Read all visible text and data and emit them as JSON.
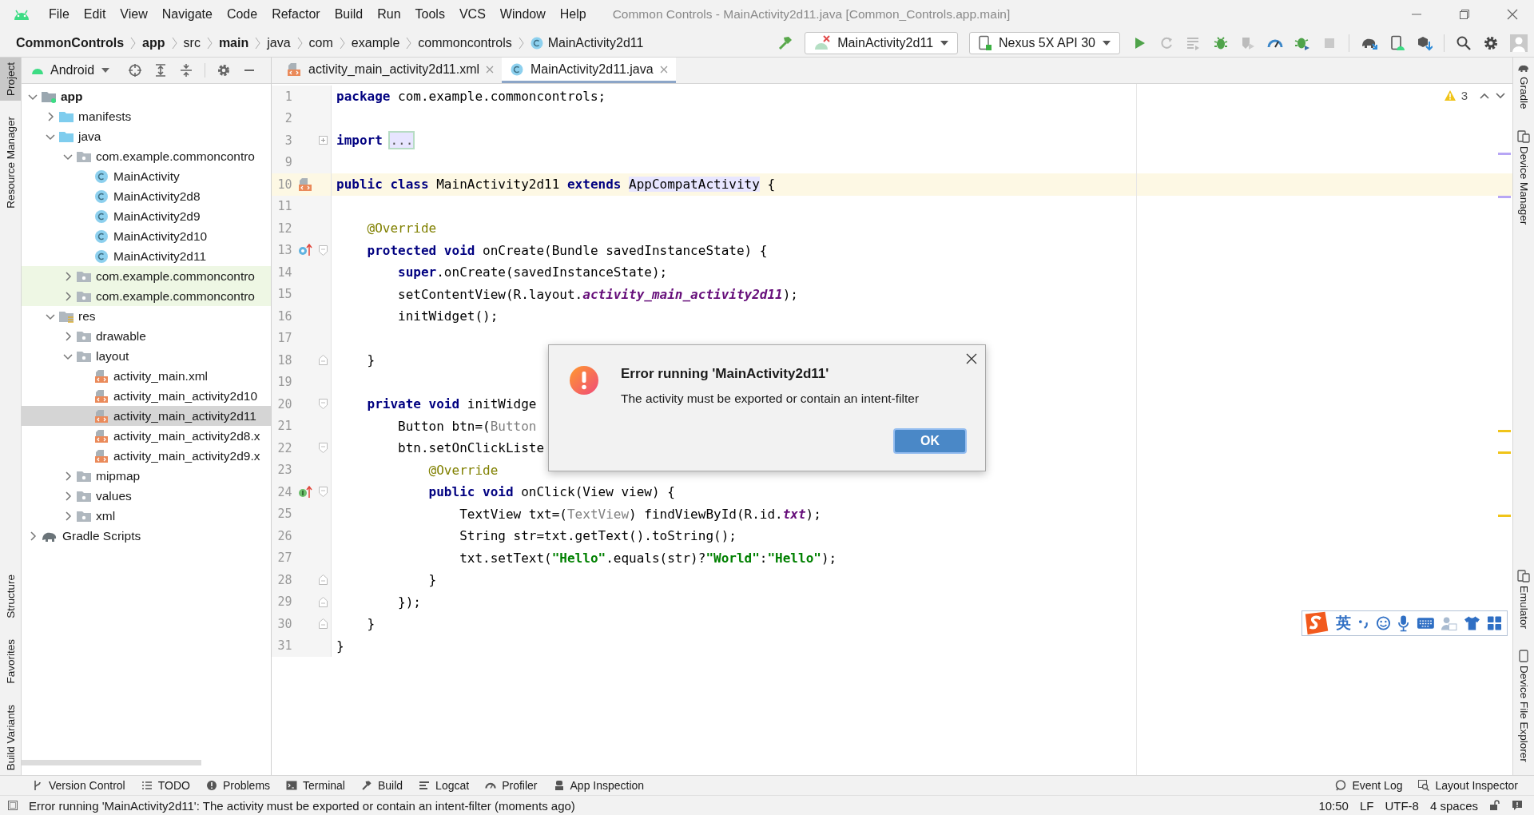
{
  "window": {
    "title": "Common Controls - MainActivity2d11.java [Common_Controls.app.main]"
  },
  "menu": [
    "File",
    "Edit",
    "View",
    "Navigate",
    "Code",
    "Refactor",
    "Build",
    "Run",
    "Tools",
    "VCS",
    "Window",
    "Help"
  ],
  "breadcrumb": [
    {
      "label": "CommonControls",
      "bold": true,
      "kind": "plain"
    },
    {
      "label": "app",
      "bold": true,
      "kind": "plain"
    },
    {
      "label": "src",
      "bold": false,
      "kind": "plain"
    },
    {
      "label": "main",
      "bold": true,
      "kind": "plain"
    },
    {
      "label": "java",
      "bold": false,
      "kind": "plain"
    },
    {
      "label": "com",
      "bold": false,
      "kind": "plain"
    },
    {
      "label": "example",
      "bold": false,
      "kind": "plain"
    },
    {
      "label": "commoncontrols",
      "bold": false,
      "kind": "plain"
    },
    {
      "label": "MainActivity2d11",
      "bold": false,
      "kind": "class"
    }
  ],
  "run_config": {
    "label": "MainActivity2d11"
  },
  "device": {
    "label": "Nexus 5X API 30"
  },
  "left_stripe": {
    "top": [
      {
        "label": "Project",
        "selected": true
      },
      {
        "label": "Resource Manager",
        "selected": false
      }
    ],
    "bottom": [
      {
        "label": "Structure",
        "selected": false
      },
      {
        "label": "Favorites",
        "selected": false
      },
      {
        "label": "Build Variants",
        "selected": false
      }
    ]
  },
  "right_stripe": {
    "top": [
      {
        "label": "Gradle",
        "kind": "elephant"
      },
      {
        "label": "Device Manager",
        "kind": "devices"
      }
    ],
    "bottom": [
      {
        "label": "Emulator",
        "kind": "devices"
      },
      {
        "label": "Device File Explorer",
        "kind": "phone"
      }
    ]
  },
  "project": {
    "view": "Android",
    "tree": [
      {
        "label": "app",
        "kind": "module",
        "expanded": true,
        "selected": false,
        "tinted": false,
        "children": [
          {
            "label": "manifests",
            "kind": "source-folder",
            "expanded": false,
            "selected": false,
            "tinted": false
          },
          {
            "label": "java",
            "kind": "source-folder",
            "expanded": true,
            "selected": false,
            "tinted": false,
            "children": [
              {
                "label": "com.example.commoncontro",
                "kind": "package",
                "expanded": true,
                "selected": false,
                "tinted": false,
                "children": [
                  {
                    "label": "MainActivity",
                    "kind": "class",
                    "selected": false,
                    "tinted": false
                  },
                  {
                    "label": "MainActivity2d8",
                    "kind": "class",
                    "selected": false,
                    "tinted": false
                  },
                  {
                    "label": "MainActivity2d9",
                    "kind": "class",
                    "selected": false,
                    "tinted": false
                  },
                  {
                    "label": "MainActivity2d10",
                    "kind": "class",
                    "selected": false,
                    "tinted": false
                  },
                  {
                    "label": "MainActivity2d11",
                    "kind": "class",
                    "selected": false,
                    "tinted": false
                  }
                ]
              },
              {
                "label": "com.example.commoncontro",
                "kind": "package",
                "expanded": false,
                "selected": false,
                "tinted": true
              },
              {
                "label": "com.example.commoncontro",
                "kind": "package",
                "expanded": false,
                "selected": false,
                "tinted": true
              }
            ]
          },
          {
            "label": "res",
            "kind": "res-folder",
            "expanded": true,
            "selected": false,
            "tinted": false,
            "children": [
              {
                "label": "drawable",
                "kind": "package",
                "expanded": false,
                "selected": false,
                "tinted": false
              },
              {
                "label": "layout",
                "kind": "package",
                "expanded": true,
                "selected": false,
                "tinted": false,
                "children": [
                  {
                    "label": "activity_main.xml",
                    "kind": "xml",
                    "selected": false,
                    "tinted": false
                  },
                  {
                    "label": "activity_main_activity2d10",
                    "kind": "xml",
                    "selected": false,
                    "tinted": false
                  },
                  {
                    "label": "activity_main_activity2d11",
                    "kind": "xml",
                    "selected": true,
                    "tinted": false
                  },
                  {
                    "label": "activity_main_activity2d8.x",
                    "kind": "xml",
                    "selected": false,
                    "tinted": false
                  },
                  {
                    "label": "activity_main_activity2d9.x",
                    "kind": "xml",
                    "selected": false,
                    "tinted": false
                  }
                ]
              },
              {
                "label": "mipmap",
                "kind": "package",
                "expanded": false,
                "selected": false,
                "tinted": false
              },
              {
                "label": "values",
                "kind": "package",
                "expanded": false,
                "selected": false,
                "tinted": false
              },
              {
                "label": "xml",
                "kind": "package",
                "expanded": false,
                "selected": false,
                "tinted": false
              }
            ]
          }
        ]
      },
      {
        "label": "Gradle Scripts",
        "kind": "gradle",
        "expanded": false,
        "selected": false,
        "tinted": false
      }
    ]
  },
  "editor": {
    "tabs": [
      {
        "label": "activity_main_activity2d11.xml",
        "kind": "xml",
        "selected": false
      },
      {
        "label": "MainActivity2d11.java",
        "kind": "class",
        "selected": true
      }
    ],
    "warnings": "3",
    "lines": [
      {
        "number": "1",
        "current": false,
        "tokens": [
          {
            "kind": "keyword",
            "text": "package"
          },
          {
            "kind": "plain",
            "text": " com.example.commoncontrols;"
          }
        ]
      },
      {
        "number": "2",
        "current": false
      },
      {
        "number": "3",
        "current": false,
        "fold": {
          "kind": "collapsed"
        },
        "tokens": [
          {
            "kind": "keyword",
            "text": "import "
          },
          {
            "kind": "folded",
            "text": "..."
          }
        ]
      },
      {
        "number": "9",
        "current": false
      },
      {
        "number": "10",
        "current": true,
        "marker": {
          "kind": "xml"
        },
        "tokens": [
          {
            "kind": "keyword",
            "text": "public class"
          },
          {
            "kind": "plain",
            "text": " MainActivity2d11 "
          },
          {
            "kind": "keyword",
            "text": "extends "
          },
          {
            "kind": "highlight",
            "text": "AppCompatActivity"
          },
          {
            "kind": "plain",
            "text": " {"
          }
        ]
      },
      {
        "number": "11",
        "current": false
      },
      {
        "number": "12",
        "current": false,
        "tokens": [
          {
            "kind": "annotation",
            "text": "    @Override"
          }
        ]
      },
      {
        "number": "13",
        "current": false,
        "marker": {
          "kind": "override"
        },
        "fold": {
          "kind": "start"
        },
        "tokens": [
          {
            "kind": "keyword",
            "text": "    protected void"
          },
          {
            "kind": "plain",
            "text": " onCreate(Bundle savedInstanceState) {"
          }
        ]
      },
      {
        "number": "14",
        "current": false,
        "tokens": [
          {
            "kind": "keyword",
            "text": "        super"
          },
          {
            "kind": "plain",
            "text": ".onCreate(savedInstanceState);"
          }
        ]
      },
      {
        "number": "15",
        "current": false,
        "tokens": [
          {
            "kind": "plain",
            "text": "        setContentView(R.layout."
          },
          {
            "kind": "field",
            "text": "activity_main_activity2d11"
          },
          {
            "kind": "plain",
            "text": ");"
          }
        ]
      },
      {
        "number": "16",
        "current": false,
        "tokens": [
          {
            "kind": "plain",
            "text": "        initWidget();"
          }
        ]
      },
      {
        "number": "17",
        "current": false
      },
      {
        "number": "18",
        "current": false,
        "fold": {
          "kind": "end"
        },
        "tokens": [
          {
            "kind": "plain",
            "text": "    }"
          }
        ]
      },
      {
        "number": "19",
        "current": false
      },
      {
        "number": "20",
        "current": false,
        "fold": {
          "kind": "start"
        },
        "tokens": [
          {
            "kind": "keyword",
            "text": "    private void"
          },
          {
            "kind": "plain",
            "text": " initWidge"
          }
        ]
      },
      {
        "number": "21",
        "current": false,
        "tokens": [
          {
            "kind": "plain",
            "text": "        Button btn=("
          },
          {
            "kind": "cast",
            "text": "Button"
          }
        ]
      },
      {
        "number": "22",
        "current": false,
        "fold": {
          "kind": "start"
        },
        "tokens": [
          {
            "kind": "plain",
            "text": "        btn.setOnClickListe"
          }
        ]
      },
      {
        "number": "23",
        "current": false,
        "tokens": [
          {
            "kind": "annotation",
            "text": "            @Override"
          }
        ]
      },
      {
        "number": "24",
        "current": false,
        "marker": {
          "kind": "implements"
        },
        "fold": {
          "kind": "start"
        },
        "tokens": [
          {
            "kind": "keyword",
            "text": "            public void"
          },
          {
            "kind": "plain",
            "text": " onClick(View view) {"
          }
        ]
      },
      {
        "number": "25",
        "current": false,
        "tokens": [
          {
            "kind": "plain",
            "text": "                TextView txt=("
          },
          {
            "kind": "cast",
            "text": "TextView"
          },
          {
            "kind": "plain",
            "text": ") findViewById(R.id."
          },
          {
            "kind": "field",
            "text": "txt"
          },
          {
            "kind": "plain",
            "text": ");"
          }
        ]
      },
      {
        "number": "26",
        "current": false,
        "tokens": [
          {
            "kind": "plain",
            "text": "                String str=txt.getText().toString();"
          }
        ]
      },
      {
        "number": "27",
        "current": false,
        "tokens": [
          {
            "kind": "plain",
            "text": "                txt.setText("
          },
          {
            "kind": "string",
            "text": "\"Hello\""
          },
          {
            "kind": "plain",
            "text": ".equals(str)?"
          },
          {
            "kind": "string",
            "text": "\"World\""
          },
          {
            "kind": "plain",
            "text": ":"
          },
          {
            "kind": "string",
            "text": "\"Hello\""
          },
          {
            "kind": "plain",
            "text": ");"
          }
        ]
      },
      {
        "number": "28",
        "current": false,
        "fold": {
          "kind": "end"
        },
        "tokens": [
          {
            "kind": "plain",
            "text": "            }"
          }
        ]
      },
      {
        "number": "29",
        "current": false,
        "fold": {
          "kind": "end"
        },
        "tokens": [
          {
            "kind": "plain",
            "text": "        });"
          }
        ]
      },
      {
        "number": "30",
        "current": false,
        "fold": {
          "kind": "end"
        },
        "tokens": [
          {
            "kind": "plain",
            "text": "    }"
          }
        ]
      },
      {
        "number": "31",
        "current": false,
        "tokens": [
          {
            "kind": "plain",
            "text": "}"
          }
        ]
      }
    ]
  },
  "dialog": {
    "title": "Error running 'MainActivity2d11'",
    "message": "The activity must be exported or contain an intent-filter",
    "button": "OK"
  },
  "ime_toolbar": {
    "mode": "英"
  },
  "tool_windows": {
    "left": [
      {
        "label": "Version Control",
        "kind": "branch"
      },
      {
        "label": "TODO",
        "kind": "list"
      },
      {
        "label": "Problems",
        "kind": "info"
      },
      {
        "label": "Terminal",
        "kind": "terminal"
      },
      {
        "label": "Build",
        "kind": "hammer"
      },
      {
        "label": "Logcat",
        "kind": "lines"
      },
      {
        "label": "Profiler",
        "kind": "gauge"
      },
      {
        "label": "App Inspection",
        "kind": "bot"
      }
    ],
    "right": [
      {
        "label": "Event Log",
        "kind": "bubble"
      },
      {
        "label": "Layout Inspector",
        "kind": "inspect"
      }
    ]
  },
  "status": {
    "message": "Error running 'MainActivity2d11': The activity must be exported or contain an intent-filter (moments ago)",
    "items": [
      "10:50",
      "LF",
      "UTF-8",
      "4 spaces"
    ]
  }
}
